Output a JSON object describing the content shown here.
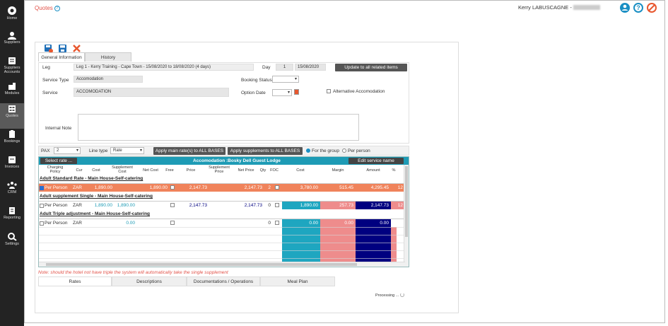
{
  "nav": [
    {
      "name": "home",
      "label": "Home"
    },
    {
      "name": "suppliers",
      "label": "Suppliers"
    },
    {
      "name": "suppliers-accounts",
      "label": "Suppliers\nAccounts"
    },
    {
      "name": "modules",
      "label": "Modules"
    },
    {
      "name": "quotes",
      "label": "Quotes"
    },
    {
      "name": "bookings",
      "label": "Bookings"
    },
    {
      "name": "invoices",
      "label": "Invoices"
    },
    {
      "name": "crm",
      "label": "CRM"
    },
    {
      "name": "reporting",
      "label": "Reporting"
    },
    {
      "name": "settings",
      "label": "Settings"
    }
  ],
  "header": {
    "title": "Quotes",
    "help": "?",
    "user": "Kerry LABUSCAGNE -"
  },
  "tabs": {
    "general": "General Information",
    "history": "History"
  },
  "form": {
    "leg_label": "Leg",
    "leg_value": "Leg 1 - Kerry Training - Cape Town - 15/08/2020 to 18/08/2020 (4 days)",
    "day_label": "Day",
    "day_value": "1",
    "date_value": "15/08/2020",
    "update_btn": "Update to all related items",
    "service_type_label": "Service Type",
    "service_type_value": "Accomodation",
    "booking_status_label": "Booking Status",
    "booking_status_value": "",
    "service_label": "Service",
    "service_value": "ACCOMODATION",
    "option_date_label": "Option Date",
    "option_date_value": "",
    "alt_accom_label": "Alternative Accomodation",
    "internal_note_label": "Internal Note",
    "internal_note_value": ""
  },
  "controls": {
    "pax_label": "PAX",
    "pax_value": "2",
    "line_type_label": "Line type",
    "line_type_value": "Rate",
    "apply_main": "Apply main rate(s) to ALL BASES",
    "apply_supp": "Apply supplements to ALL BASES",
    "for_group": "For the group",
    "per_person": "Per person"
  },
  "grid": {
    "select_rate": "Select rate ...",
    "title": "Accomodation :Bosky Dell Guest Lodge",
    "edit_service": "Edit service name",
    "columns": [
      "Charging\nPolicy",
      "Cur",
      "Cost",
      "Supplement\nCost",
      "Net Cost",
      "Free",
      "Price",
      "Supplement\nPrice",
      "Net Price",
      "Qty",
      "FOC",
      "Cost",
      "Margin",
      "Amount",
      "%"
    ],
    "sections": [
      {
        "title": "Adult Standard Rate - Main House-Self-catering",
        "row": {
          "policy": "Per Person",
          "cur": "ZAR",
          "cost": "1,890.00",
          "supp_cost": "",
          "net_cost": "1,890.00",
          "price": "2,147.73",
          "supp_price": "",
          "net_price": "2,147.73",
          "qty": "2",
          "tcost": "3,780.00",
          "margin": "515.45",
          "amount": "4,295.45",
          "pct": "12"
        }
      },
      {
        "title": "Adult supplement Single - Main House-Self-catering",
        "row": {
          "policy": "Per Person",
          "cur": "ZAR",
          "cost": "1,890.00",
          "supp_cost": "1,890.00",
          "net_cost": "",
          "price": "2,147.73",
          "supp_price": "",
          "net_price": "2,147.73",
          "qty": "0",
          "tcost": "1,890.00",
          "margin": "257.73",
          "amount": "2,147.73",
          "pct": "12"
        }
      },
      {
        "title": "Adult Triple adjustment - Main House-Self-catering",
        "row": {
          "policy": "Per Person",
          "cur": "ZAR",
          "cost": "",
          "supp_cost": "0.00",
          "net_cost": "",
          "price": "",
          "supp_price": "",
          "net_price": "",
          "qty": "0",
          "tcost": "0.00",
          "margin": "0.00",
          "amount": "0.00",
          "pct": ""
        }
      }
    ]
  },
  "note": "Note: should the hotel not have triple the system will automatically take the single supplement",
  "bottom_tabs": [
    "Rates",
    "Descriptions",
    "Documentations / Operations",
    "Meal Plan"
  ],
  "status": "Processing ..."
}
